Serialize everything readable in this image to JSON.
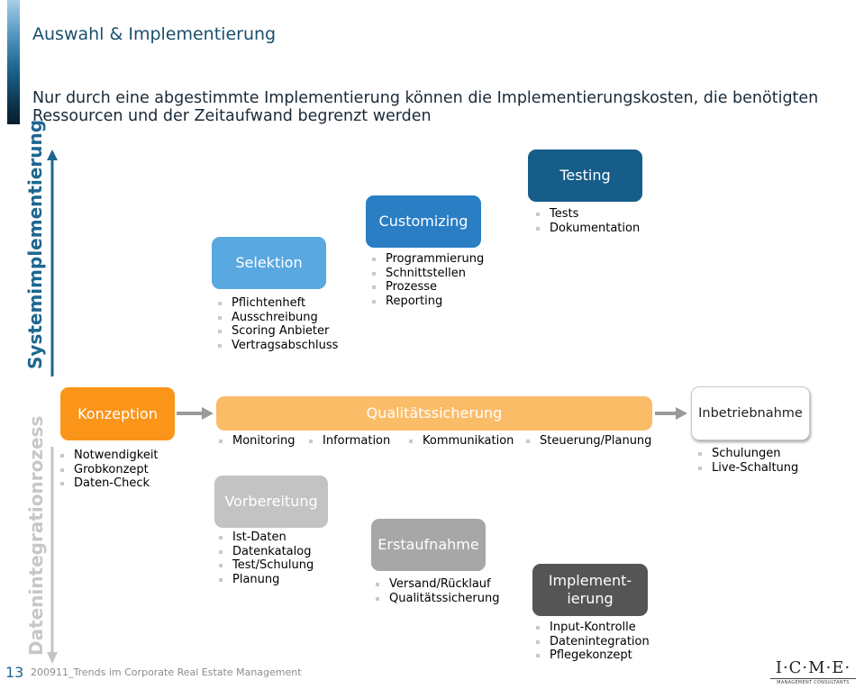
{
  "header": {
    "title": "Auswahl & Implementierung",
    "subtitle": "Nur durch eine abgestimmte Implementierung können die Implementierungskosten, die benötigten Ressourcen und der Zeitaufwand begrenzt werden"
  },
  "axes": {
    "system": "Systemimplementierung",
    "data": "Datenintegrationrozess"
  },
  "system_steps": [
    {
      "label": "Selektion",
      "items": [
        "Pflichtenheft",
        "Ausschreibung",
        "Scoring Anbieter",
        "Vertragsabschluss"
      ],
      "color": "#5aa8e0"
    },
    {
      "label": "Customizing",
      "items": [
        "Programmierung",
        "Schnittstellen",
        "Prozesse",
        "Reporting"
      ],
      "color": "#2a7ec3"
    },
    {
      "label": "Testing",
      "items": [
        "Tests",
        "Dokumentation"
      ],
      "color": "#165d8a"
    }
  ],
  "phases": {
    "konzeption": {
      "label": "Konzeption",
      "items": [
        "Notwendigkeit",
        "Grobkonzept",
        "Daten-Check"
      ],
      "color": "#fb951a"
    },
    "qualitaetssicherung": {
      "label": "Qualitätssicherung",
      "items": [
        "Monitoring",
        "Information",
        "Kommunikation",
        "Steuerung/Planung"
      ],
      "color": "#fbbc68"
    },
    "inbetriebnahme": {
      "label": "Inbetriebnahme",
      "items": [
        "Schulungen",
        "Live-Schaltung"
      ]
    }
  },
  "data_steps": [
    {
      "label": "Vorbereitung",
      "items": [
        "Ist-Daten",
        "Datenkatalog",
        "Test/Schulung",
        "Planung"
      ],
      "color": "#c3c3c3"
    },
    {
      "label": "Erstaufnahme",
      "items": [
        "Versand/Rücklauf",
        "Qualitätssicherung"
      ],
      "color": "#a7a7a7"
    },
    {
      "label": "Implement-ierung",
      "items": [
        "Input-Kontrolle",
        "Datenintegration",
        "Pflegekonzept"
      ],
      "color": "#555555"
    }
  ],
  "footer": {
    "page_number": "13",
    "document": "200911_Trends im Corporate Real Estate Management"
  },
  "logo": {
    "name": "I·C·M·E·",
    "tagline": "MANAGEMENT CONSULTANTS"
  }
}
